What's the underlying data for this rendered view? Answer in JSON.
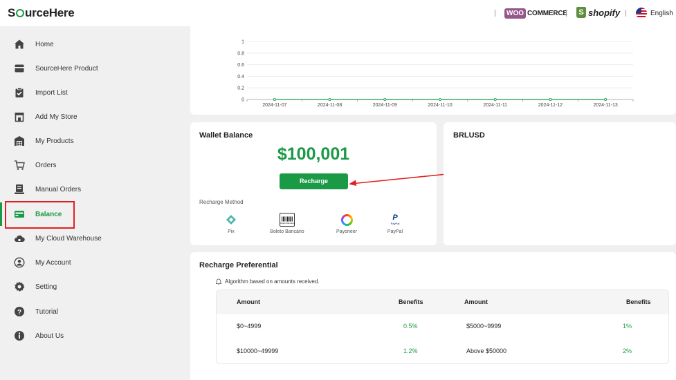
{
  "header": {
    "logo": {
      "pre": "S",
      "post": "urceHere"
    },
    "woo": {
      "badge": "WOO",
      "text": "COMMERCE"
    },
    "shopify": {
      "bag": "S",
      "text": "shopify"
    },
    "language": "English"
  },
  "sidebar": {
    "items": [
      {
        "label": "Home",
        "icon": "home-icon"
      },
      {
        "label": "SourceHere Product",
        "icon": "product-icon"
      },
      {
        "label": "Import List",
        "icon": "clipboard-check-icon"
      },
      {
        "label": "Add My Store",
        "icon": "store-icon"
      },
      {
        "label": "My Products",
        "icon": "warehouse-icon"
      },
      {
        "label": "Orders",
        "icon": "cart-icon"
      },
      {
        "label": "Manual Orders",
        "icon": "manual-order-icon"
      },
      {
        "label": "Balance",
        "icon": "wallet-icon",
        "active": true
      },
      {
        "label": "My Cloud Warehouse",
        "icon": "cloud-icon"
      },
      {
        "label": "My Account",
        "icon": "user-icon"
      },
      {
        "label": "Setting",
        "icon": "gear-icon"
      },
      {
        "label": "Tutorial",
        "icon": "question-icon"
      },
      {
        "label": "About Us",
        "icon": "info-icon"
      }
    ]
  },
  "chart_data": {
    "type": "line",
    "x": [
      "2024-11-07",
      "2024-11-08",
      "2024-11-09",
      "2024-11-10",
      "2024-11-11",
      "2024-11-12",
      "2024-11-13"
    ],
    "series": [
      {
        "values": [
          0,
          0,
          0,
          0,
          0,
          0,
          0
        ]
      }
    ],
    "yticks": [
      "0",
      "0.2",
      "0.4",
      "0.6",
      "0.8",
      "1"
    ],
    "ylim": [
      0,
      1
    ],
    "grid": true,
    "color": "#1a9a45"
  },
  "wallet": {
    "title": "Wallet Balance",
    "amount": "$100,001",
    "recharge_label": "Recharge",
    "method_label": "Recharge Method",
    "methods": [
      {
        "label": "Pix",
        "icon": "pix-icon"
      },
      {
        "label": "Boleto Bancário",
        "icon": "barcode-icon",
        "icon_text": "Boleto Bancário"
      },
      {
        "label": "Payoneer",
        "icon": "payoneer-icon"
      },
      {
        "label": "PayPal",
        "icon": "paypal-icon",
        "icon_text": "PayPal"
      }
    ]
  },
  "brl": {
    "title": "BRLUSD"
  },
  "preferential": {
    "title": "Recharge Preferential",
    "notice": "Algorithm based on amounts received.",
    "headers": [
      "Amount",
      "Benefits",
      "Amount",
      "Benefits"
    ],
    "rows": [
      [
        "$0~4999",
        "0.5%",
        "$5000~9999",
        "1%"
      ],
      [
        "$10000~49999",
        "1.2%",
        "Above $50000",
        "2%"
      ]
    ]
  },
  "colors": {
    "accent": "#1a9a45",
    "annotation": "#e02020"
  }
}
